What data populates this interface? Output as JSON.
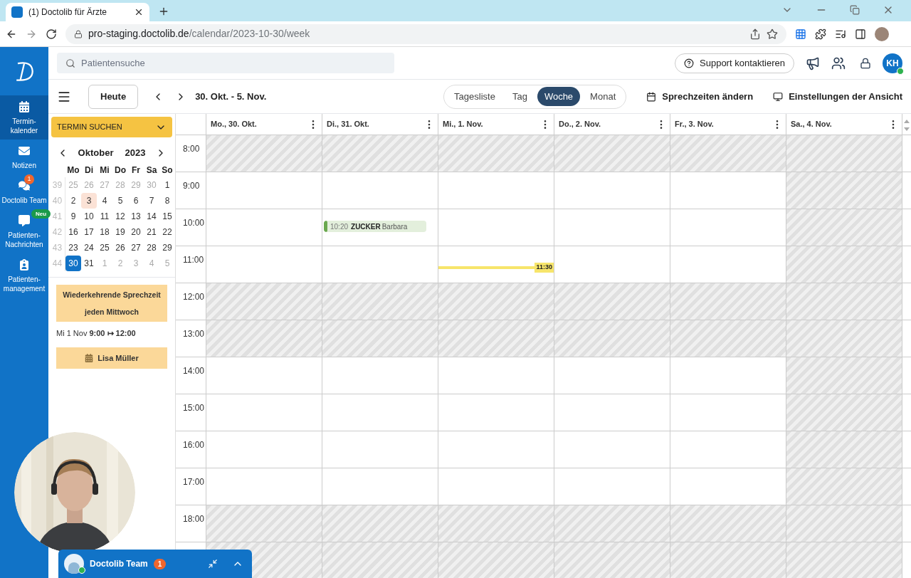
{
  "browser": {
    "tab_title": "(1) Doctolib für Ärzte",
    "url_host": "pro-staging.doctolib.de",
    "url_path": "/calendar/2023-10-30/week"
  },
  "sidebar": {
    "items": [
      {
        "label": "Termin-\nkalender",
        "selected": true
      },
      {
        "label": "Notizen",
        "selected": false
      },
      {
        "label": "Doctolib Team",
        "selected": false,
        "badge": "1"
      },
      {
        "label": "Patienten-\nNachrichten",
        "selected": false,
        "tag": "Neu"
      },
      {
        "label": "Patienten-\nmanagement",
        "selected": false
      }
    ]
  },
  "header": {
    "search_placeholder": "Patientensuche",
    "support": "Support kontaktieren",
    "avatar": "KH"
  },
  "toolbar": {
    "today": "Heute",
    "range": "30. Okt. - 5. Nov.",
    "views": [
      {
        "label": "Tagesliste",
        "selected": false
      },
      {
        "label": "Tag",
        "selected": false
      },
      {
        "label": "Woche",
        "selected": true
      },
      {
        "label": "Monat",
        "selected": false
      }
    ],
    "actions": [
      {
        "label": "Sprechzeiten ändern"
      },
      {
        "label": "Einstellungen der Ansicht"
      }
    ]
  },
  "left_panel": {
    "search_button": "TERMIN SUCHEN",
    "mini_calendar": {
      "month": "Oktober",
      "year": "2023",
      "weekdays": [
        "Mo",
        "Di",
        "Mi",
        "Do",
        "Fr",
        "Sa",
        "So"
      ],
      "weeks": [
        {
          "number": "39",
          "days": [
            {
              "d": "25",
              "outside": true,
              "today": false,
              "selected": false
            },
            {
              "d": "26",
              "outside": true,
              "today": false,
              "selected": false
            },
            {
              "d": "27",
              "outside": true,
              "today": false,
              "selected": false
            },
            {
              "d": "28",
              "outside": true,
              "today": false,
              "selected": false
            },
            {
              "d": "29",
              "outside": true,
              "today": false,
              "selected": false
            },
            {
              "d": "30",
              "outside": true,
              "today": false,
              "selected": false
            },
            {
              "d": "1",
              "outside": false,
              "today": false,
              "selected": false
            }
          ]
        },
        {
          "number": "40",
          "days": [
            {
              "d": "2",
              "outside": false,
              "today": false,
              "selected": false
            },
            {
              "d": "3",
              "outside": false,
              "today": true,
              "selected": false
            },
            {
              "d": "4",
              "outside": false,
              "today": false,
              "selected": false
            },
            {
              "d": "5",
              "outside": false,
              "today": false,
              "selected": false
            },
            {
              "d": "6",
              "outside": false,
              "today": false,
              "selected": false
            },
            {
              "d": "7",
              "outside": false,
              "today": false,
              "selected": false
            },
            {
              "d": "8",
              "outside": false,
              "today": false,
              "selected": false
            }
          ]
        },
        {
          "number": "41",
          "days": [
            {
              "d": "9",
              "outside": false,
              "today": false,
              "selected": false
            },
            {
              "d": "10",
              "outside": false,
              "today": false,
              "selected": false
            },
            {
              "d": "11",
              "outside": false,
              "today": false,
              "selected": false
            },
            {
              "d": "12",
              "outside": false,
              "today": false,
              "selected": false
            },
            {
              "d": "13",
              "outside": false,
              "today": false,
              "selected": false
            },
            {
              "d": "14",
              "outside": false,
              "today": false,
              "selected": false
            },
            {
              "d": "15",
              "outside": false,
              "today": false,
              "selected": false
            }
          ]
        },
        {
          "number": "42",
          "days": [
            {
              "d": "16",
              "outside": false,
              "today": false,
              "selected": false
            },
            {
              "d": "17",
              "outside": false,
              "today": false,
              "selected": false
            },
            {
              "d": "18",
              "outside": false,
              "today": false,
              "selected": false
            },
            {
              "d": "19",
              "outside": false,
              "today": false,
              "selected": false
            },
            {
              "d": "20",
              "outside": false,
              "today": false,
              "selected": false
            },
            {
              "d": "21",
              "outside": false,
              "today": false,
              "selected": false
            },
            {
              "d": "22",
              "outside": false,
              "today": false,
              "selected": false
            }
          ]
        },
        {
          "number": "43",
          "days": [
            {
              "d": "23",
              "outside": false,
              "today": false,
              "selected": false
            },
            {
              "d": "24",
              "outside": false,
              "today": false,
              "selected": false
            },
            {
              "d": "25",
              "outside": false,
              "today": false,
              "selected": false
            },
            {
              "d": "26",
              "outside": false,
              "today": false,
              "selected": false
            },
            {
              "d": "27",
              "outside": false,
              "today": false,
              "selected": false
            },
            {
              "d": "28",
              "outside": false,
              "today": false,
              "selected": false
            },
            {
              "d": "29",
              "outside": false,
              "today": false,
              "selected": false
            }
          ]
        },
        {
          "number": "44",
          "days": [
            {
              "d": "30",
              "outside": false,
              "today": false,
              "selected": true
            },
            {
              "d": "31",
              "outside": false,
              "today": false,
              "selected": false
            },
            {
              "d": "1",
              "outside": true,
              "today": false,
              "selected": false
            },
            {
              "d": "2",
              "outside": true,
              "today": false,
              "selected": false
            },
            {
              "d": "3",
              "outside": true,
              "today": false,
              "selected": false
            },
            {
              "d": "4",
              "outside": true,
              "today": false,
              "selected": false
            },
            {
              "d": "5",
              "outside": true,
              "today": false,
              "selected": false
            }
          ]
        }
      ]
    },
    "recurring": {
      "title": "Wiederkehrende Sprechzeit jeden Mittwoch",
      "when": "Mi 1 Nov **9:00 ↦ 12:00**",
      "person": "Lisa Müller"
    }
  },
  "calendar": {
    "days": [
      "Mo., 30. Okt.",
      "Di., 31. Okt.",
      "Mi., 1. Nov.",
      "Do., 2. Nov.",
      "Fr., 3. Nov.",
      "Sa., 4. Nov."
    ],
    "hours": [
      {
        "label": "8:00",
        "cells": [
          {
            "shaded": true
          },
          {
            "shaded": true
          },
          {
            "shaded": true
          },
          {
            "shaded": true
          },
          {
            "shaded": true
          },
          {
            "shaded": true
          }
        ]
      },
      {
        "label": "9:00",
        "cells": [
          {
            "shaded": false
          },
          {
            "shaded": false
          },
          {
            "shaded": false
          },
          {
            "shaded": false
          },
          {
            "shaded": false
          },
          {
            "shaded": true
          }
        ]
      },
      {
        "label": "10:00",
        "cells": [
          {
            "shaded": false
          },
          {
            "shaded": false,
            "appointment": {
              "time": "10:20",
              "last_name": "ZUCKER",
              "first_name": "Barbara",
              "color": "#6aa84f"
            }
          },
          {
            "shaded": false
          },
          {
            "shaded": false
          },
          {
            "shaded": false
          },
          {
            "shaded": true
          }
        ]
      },
      {
        "label": "11:00",
        "cells": [
          {
            "shaded": false
          },
          {
            "shaded": false
          },
          {
            "shaded": false,
            "now_line": "11:30"
          },
          {
            "shaded": false
          },
          {
            "shaded": false
          },
          {
            "shaded": true
          }
        ]
      },
      {
        "label": "12:00",
        "cells": [
          {
            "shaded": true
          },
          {
            "shaded": true
          },
          {
            "shaded": true
          },
          {
            "shaded": true
          },
          {
            "shaded": true
          },
          {
            "shaded": true
          }
        ]
      },
      {
        "label": "13:00",
        "cells": [
          {
            "shaded": true
          },
          {
            "shaded": true
          },
          {
            "shaded": true
          },
          {
            "shaded": true
          },
          {
            "shaded": true
          },
          {
            "shaded": true
          }
        ]
      },
      {
        "label": "14:00",
        "cells": [
          {
            "shaded": false
          },
          {
            "shaded": false
          },
          {
            "shaded": false
          },
          {
            "shaded": false
          },
          {
            "shaded": false
          },
          {
            "shaded": true
          }
        ]
      },
      {
        "label": "15:00",
        "cells": [
          {
            "shaded": false
          },
          {
            "shaded": false
          },
          {
            "shaded": false
          },
          {
            "shaded": false
          },
          {
            "shaded": false
          },
          {
            "shaded": true
          }
        ]
      },
      {
        "label": "16:00",
        "cells": [
          {
            "shaded": false
          },
          {
            "shaded": false
          },
          {
            "shaded": false
          },
          {
            "shaded": false
          },
          {
            "shaded": false
          },
          {
            "shaded": true
          }
        ]
      },
      {
        "label": "17:00",
        "cells": [
          {
            "shaded": false
          },
          {
            "shaded": false
          },
          {
            "shaded": false
          },
          {
            "shaded": false
          },
          {
            "shaded": false
          },
          {
            "shaded": true
          }
        ]
      },
      {
        "label": "18:00",
        "cells": [
          {
            "shaded": true
          },
          {
            "shaded": true
          },
          {
            "shaded": true
          },
          {
            "shaded": true
          },
          {
            "shaded": true
          },
          {
            "shaded": true
          }
        ]
      },
      {
        "cells": [
          {
            "shaded": true
          },
          {
            "shaded": true
          },
          {
            "shaded": true
          },
          {
            "shaded": true
          },
          {
            "shaded": true
          },
          {
            "shaded": true
          }
        ]
      }
    ]
  },
  "chat": {
    "title": "Doctolib Team",
    "badge": "1"
  }
}
